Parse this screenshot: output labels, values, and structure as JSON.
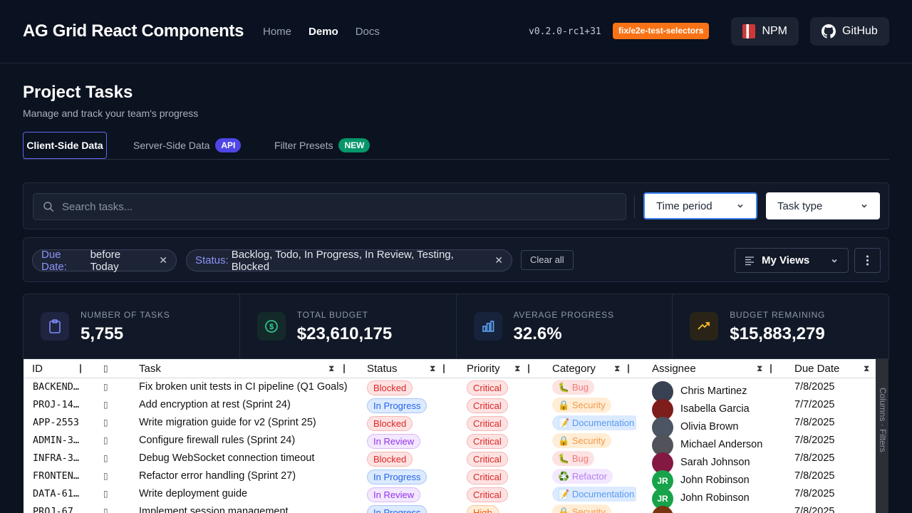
{
  "header": {
    "brand": "AG Grid React Components",
    "nav": [
      "Home",
      "Demo",
      "Docs"
    ],
    "version": "v0.2.0-rc1+31",
    "branch": "fix/e2e-test-selectors",
    "npm_label": "NPM",
    "github_label": "GitHub"
  },
  "page": {
    "title": "Project Tasks",
    "subtitle": "Manage and track your team's progress"
  },
  "tabs": [
    {
      "label": "Client-Side Data",
      "badge": ""
    },
    {
      "label": "Server-Side Data",
      "badge": "API"
    },
    {
      "label": "Filter Presets",
      "badge": "NEW"
    }
  ],
  "toolbar": {
    "search_placeholder": "Search tasks...",
    "time_period": "Time period",
    "task_type": "Task type"
  },
  "filters": {
    "chips": [
      {
        "key": "Due Date:",
        "value": "before Today"
      },
      {
        "key": "Status:",
        "value": "Backlog, Todo, In Progress, In Review, Testing, Blocked"
      }
    ],
    "clear_all": "Clear all",
    "views_label": "My Views"
  },
  "stats": [
    {
      "label": "NUMBER OF TASKS",
      "value": "5,755",
      "icon": "clipboard-icon",
      "color": "#818cf8"
    },
    {
      "label": "TOTAL BUDGET",
      "value": "$23,610,175",
      "icon": "dollar-icon",
      "color": "#34d399"
    },
    {
      "label": "AVERAGE PROGRESS",
      "value": "32.6%",
      "icon": "bar-chart-icon",
      "color": "#60a5fa"
    },
    {
      "label": "BUDGET REMAINING",
      "value": "$15,883,279",
      "icon": "trending-up-icon",
      "color": "#fbbf24"
    }
  ],
  "grid": {
    "columns": [
      "ID",
      "Task",
      "Status",
      "Priority",
      "Category",
      "Assignee",
      "Due Date"
    ],
    "sidebar_labels": [
      "Columns",
      "Filters"
    ],
    "rows": [
      {
        "id": "BACKEND…",
        "task": "Fix broken unit tests in CI pipeline (Q1 Goals)",
        "status": "Blocked",
        "priority": "Critical",
        "category": "Bug",
        "cat_icon": "🐛",
        "assignee": "Chris Martinez",
        "initials": "",
        "due": "7/8/2025"
      },
      {
        "id": "PROJ-14…",
        "task": "Add encryption at rest (Sprint 24)",
        "status": "In Progress",
        "priority": "Critical",
        "category": "Security",
        "cat_icon": "🔒",
        "assignee": "Isabella Garcia",
        "initials": "",
        "due": "7/7/2025"
      },
      {
        "id": "APP-2553",
        "task": "Write migration guide for v2 (Sprint 25)",
        "status": "Blocked",
        "priority": "Critical",
        "category": "Documentation",
        "cat_icon": "📝",
        "assignee": "Olivia Brown",
        "initials": "",
        "due": "7/8/2025"
      },
      {
        "id": "ADMIN-3…",
        "task": "Configure firewall rules (Sprint 24)",
        "status": "In Review",
        "priority": "Critical",
        "category": "Security",
        "cat_icon": "🔒",
        "assignee": "Michael Anderson",
        "initials": "",
        "due": "7/8/2025"
      },
      {
        "id": "INFRA-3…",
        "task": "Debug WebSocket connection timeout",
        "status": "Blocked",
        "priority": "Critical",
        "category": "Bug",
        "cat_icon": "🐛",
        "assignee": "Sarah Johnson",
        "initials": "",
        "due": "7/8/2025"
      },
      {
        "id": "FRONTEN…",
        "task": "Refactor error handling (Sprint 27)",
        "status": "In Progress",
        "priority": "Critical",
        "category": "Refactor",
        "cat_icon": "♻️",
        "assignee": "John Robinson",
        "initials": "JR",
        "due": "7/8/2025"
      },
      {
        "id": "DATA-61…",
        "task": "Write deployment guide",
        "status": "In Review",
        "priority": "Critical",
        "category": "Documentation",
        "cat_icon": "📝",
        "assignee": "John Robinson",
        "initials": "JR",
        "due": "7/8/2025"
      },
      {
        "id": "PROJ-67…",
        "task": "Implement session management",
        "status": "In Progress",
        "priority": "High",
        "category": "Security",
        "cat_icon": "🔒",
        "assignee": "",
        "initials": "",
        "due": "7/8/2025"
      }
    ]
  }
}
